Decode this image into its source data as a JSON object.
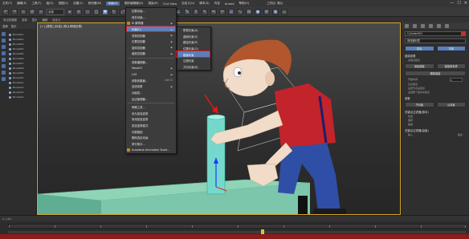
{
  "menubar": {
    "items": [
      "文件(F)",
      "编辑(E)",
      "工具(T)",
      "组(G)",
      "视图(V)",
      "创建(C)",
      "修改器(M)",
      "动画(A)",
      "图形编辑器(D)",
      "渲染(R)",
      "Civil View",
      "自定义(U)",
      "脚本(S)",
      "内容",
      "Arnold",
      "帮助(H)"
    ],
    "active_index": 7,
    "window": {
      "minimize": "—",
      "maximize": "☐",
      "close": "✕"
    },
    "workspace": "工作区: 默认"
  },
  "toolbar": {
    "layer_combo": "全部",
    "view_combo": "视图"
  },
  "subbar": {
    "items": [
      "选择",
      "显示",
      "编辑",
      "自定义"
    ],
    "left_label": "多边形建模"
  },
  "explorer": {
    "tabs": [
      "选择",
      "显示"
    ],
    "rows": [
      "Bone001",
      "Bone002",
      "Bone003",
      "Bone004",
      "Bone005",
      "Bone006",
      "Bone007",
      "Bone008",
      "Bone009",
      "Bone010",
      "Bone011",
      "Bone012",
      "Bone013",
      "Bone014"
    ]
  },
  "viewport": {
    "label": "[+] [透视] [标准] [默认明暗处理]"
  },
  "animation_menu": {
    "items": [
      {
        "label": "加载动画...",
        "shortcut": "",
        "submenu": false
      },
      {
        "label": "保存动画...",
        "shortcut": "",
        "submenu": false
      },
      {
        "label": "IK 解算器",
        "shortcut": "",
        "submenu": true
      },
      {
        "label": "约束(C)",
        "shortcut": "",
        "submenu": true,
        "highlight": true
      },
      {
        "label": "变换控制器",
        "shortcut": "",
        "submenu": true
      },
      {
        "label": "位置控制器",
        "shortcut": "",
        "submenu": true
      },
      {
        "label": "旋转控制器",
        "shortcut": "",
        "submenu": true
      },
      {
        "label": "缩放控制器",
        "shortcut": "",
        "submenu": true
      },
      {
        "label": "参数编辑器...",
        "shortcut": "",
        "submenu": false
      },
      {
        "label": "MassFX",
        "shortcut": "",
        "submenu": true
      },
      {
        "label": "CAT",
        "shortcut": "",
        "submenu": true
      },
      {
        "label": "参数收集器...",
        "shortcut": "Alt+2",
        "submenu": false
      },
      {
        "label": "连线参数",
        "shortcut": "",
        "submenu": true
      },
      {
        "label": "动画层...",
        "shortcut": "",
        "submenu": false
      },
      {
        "label": "反应管理器...",
        "shortcut": "",
        "submenu": false
      },
      {
        "label": "骨骼工具...",
        "shortcut": "",
        "submenu": false
      },
      {
        "label": "设为蒙皮姿势",
        "shortcut": "",
        "submenu": false
      },
      {
        "label": "采用蒙皮姿势",
        "shortcut": "",
        "submenu": false
      },
      {
        "label": "蒙皮姿势模式",
        "shortcut": "",
        "submenu": false
      },
      {
        "label": "切换限制",
        "shortcut": "",
        "submenu": false
      },
      {
        "label": "删除选定动画",
        "shortcut": "",
        "submenu": false
      },
      {
        "label": "穿行助手...",
        "shortcut": "",
        "submenu": false
      },
      {
        "label": "Autodesk Animation Store...",
        "shortcut": "",
        "submenu": false
      }
    ]
  },
  "constraints_submenu": {
    "items": [
      {
        "label": "附着约束(A)",
        "highlight": false
      },
      {
        "label": "曲面约束(S)",
        "highlight": false
      },
      {
        "label": "路径约束(P)",
        "highlight": false
      },
      {
        "label": "位置约束(O)",
        "highlight": false
      },
      {
        "label": "链接约束",
        "highlight": true
      },
      {
        "label": "注视约束",
        "highlight": false
      },
      {
        "label": "方向约束(R)",
        "highlight": false
      }
    ]
  },
  "cmdpanel": {
    "object_name": "Cylinder001",
    "modifier_list": "修改器列表",
    "buttons_row1": [
      "挤出",
      "车削"
    ],
    "section_params": "链接参数",
    "key_mode": "关键点模式",
    "link_buttons": [
      "添加链接",
      "链接到世界",
      "删除链接"
    ],
    "start_time_label": "开始时间:",
    "start_time": "0",
    "key_options": [
      "无关键点",
      "设置节点关键点",
      "设置整个层次关键点"
    ],
    "section_cols": "参数",
    "options": [
      "子对象",
      "父对象"
    ],
    "section_display": "关键点过滤器(基本)",
    "display_rows": [
      "位置",
      "旋转",
      "缩放"
    ],
    "section_adv": "关键点过滤器(高级)",
    "adv_rows": [
      "输入",
      "输出"
    ]
  },
  "timebar": {
    "frame": "0 / 100"
  },
  "timeline": {
    "ticks": [
      "0",
      "10",
      "20",
      "30",
      "40",
      "50",
      "60",
      "70",
      "80",
      "90",
      "100"
    ]
  },
  "colors": {
    "highlight": "#5d7eb8",
    "annotation": "#e01818",
    "character_shirt": "#c3232a",
    "character_jeans": "#2f4fa6",
    "cylinder": "#74d9cc",
    "board": "#8fd4b6"
  }
}
